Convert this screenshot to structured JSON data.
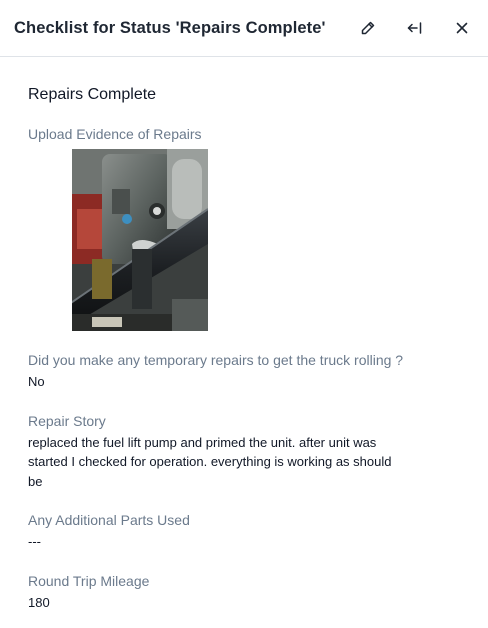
{
  "header": {
    "title": "Checklist for Status 'Repairs Complete'"
  },
  "section": {
    "title": "Repairs Complete"
  },
  "fields": {
    "evidence_label": "Upload Evidence of Repairs",
    "temp_repairs_label": "Did you make any temporary repairs to get the truck rolling ?",
    "temp_repairs_value": "No",
    "repair_story_label": "Repair Story",
    "repair_story_value": "replaced the fuel lift pump and primed the unit. after unit was started I checked for operation. everything is working as should be",
    "parts_label": "Any Additional Parts Used",
    "parts_value": "---",
    "mileage_label": "Round Trip Mileage",
    "mileage_value": "180"
  },
  "icons": {
    "edit": "pencil-icon",
    "collapse": "arrow-left-bar-icon",
    "close": "close-icon"
  },
  "colors": {
    "label": "#6b7a8c",
    "divider": "#dfe3e8"
  }
}
